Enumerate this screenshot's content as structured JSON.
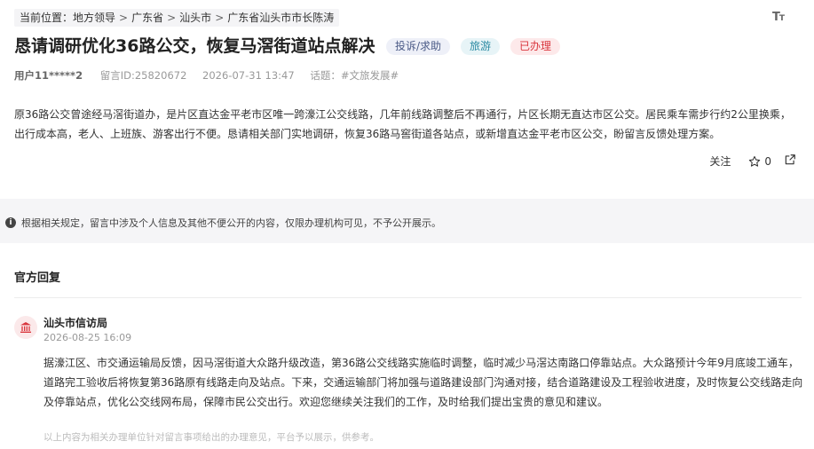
{
  "breadcrumb": {
    "prefix": "当前位置：",
    "items": [
      "地方领导",
      "广东省",
      "汕头市",
      "广东省汕头市市长陈涛"
    ]
  },
  "toolbar": {
    "font_size_label": "Tт"
  },
  "post": {
    "title": "恳请调研优化36路公交，恢复马滘街道站点解决",
    "tags": {
      "type": "投诉/求助",
      "topic": "旅游",
      "status": "已办理"
    },
    "user": "用户11*****2",
    "message_id": "留言ID:25820672",
    "datetime": "2026-07-31 13:47",
    "topic_label": "话题：#文旅发展#",
    "content": "原36路公交曾途经马滘街道办，是片区直达金平老市区唯一跨濠江公交线路，几年前线路调整后不再通行，片区长期无直达市区公交。居民乘车需步行约2公里换乘，出行成本高，老人、上班族、游客出行不便。恳请相关部门实地调研，恢复36路马窖街道各站点，或新增直达金平老市区公交，盼留言反馈处理方案。",
    "follow_label": "关注",
    "like_count": "0"
  },
  "privacy_notice": "根据相关规定，留言中涉及个人信息及其他不便公开的内容，仅限办理机构可见，不予公开展示。",
  "official_reply": {
    "section_title": "官方回复",
    "department": "汕头市信访局",
    "datetime": "2026-08-25 16:09",
    "content": "据濠江区、市交通运输局反馈，因马滘街道大众路升级改造，第36路公交线路实施临时调整，临时减少马滘达南路口停靠站点。大众路预计今年9月底竣工通车，道路完工验收后将恢复第36路原有线路走向及站点。下来，交通运输部门将加强与道路建设部门沟通对接，结合道路建设及工程验收进度，及时恢复公交线路走向及停靠站点，优化公交线网布局，保障市民公交出行。欢迎您继续关注我们的工作，及时给我们提出宝贵的意见和建议。",
    "footnote": "以上内容为相关办理单位针对留言事项给出的办理意见，平台予以展示，供参考。"
  }
}
